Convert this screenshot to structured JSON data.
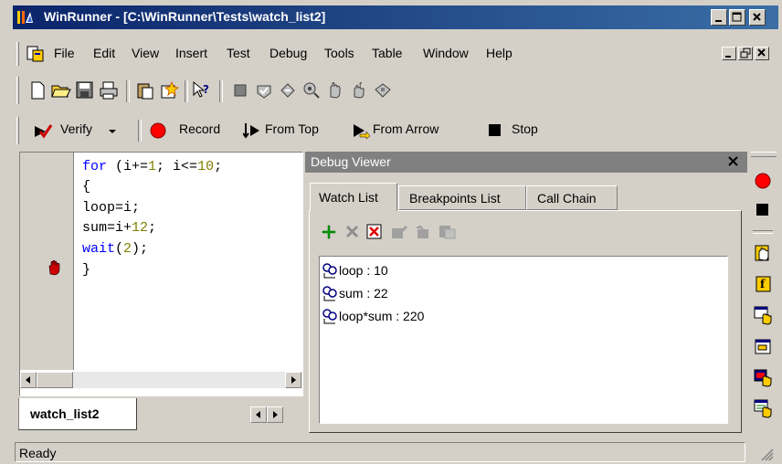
{
  "window": {
    "title": "WinRunner - [C:\\WinRunner\\Tests\\watch_list2]"
  },
  "menu": [
    "File",
    "Edit",
    "View",
    "Insert",
    "Test",
    "Debug",
    "Tools",
    "Table",
    "Window",
    "Help"
  ],
  "run_toolbar": {
    "verify_label": "Verify",
    "record_label": "Record",
    "from_top_label": "From Top",
    "from_arrow_label": "From Arrow",
    "stop_label": "Stop"
  },
  "editor": {
    "tab_label": "watch_list2",
    "breakpoint_line": 5
  },
  "debug_viewer": {
    "title": "Debug Viewer",
    "tabs": [
      "Watch List",
      "Breakpoints List",
      "Call Chain"
    ],
    "active_tab": "Watch List",
    "watch_items": [
      "loop : 10",
      "sum : 22",
      "loop*sum : 220"
    ]
  },
  "status": {
    "text": "Ready"
  },
  "colors": {
    "title_bar": "#0a246a",
    "keyword": "#0000ff",
    "number": "#808000",
    "record": "#ff0000"
  }
}
